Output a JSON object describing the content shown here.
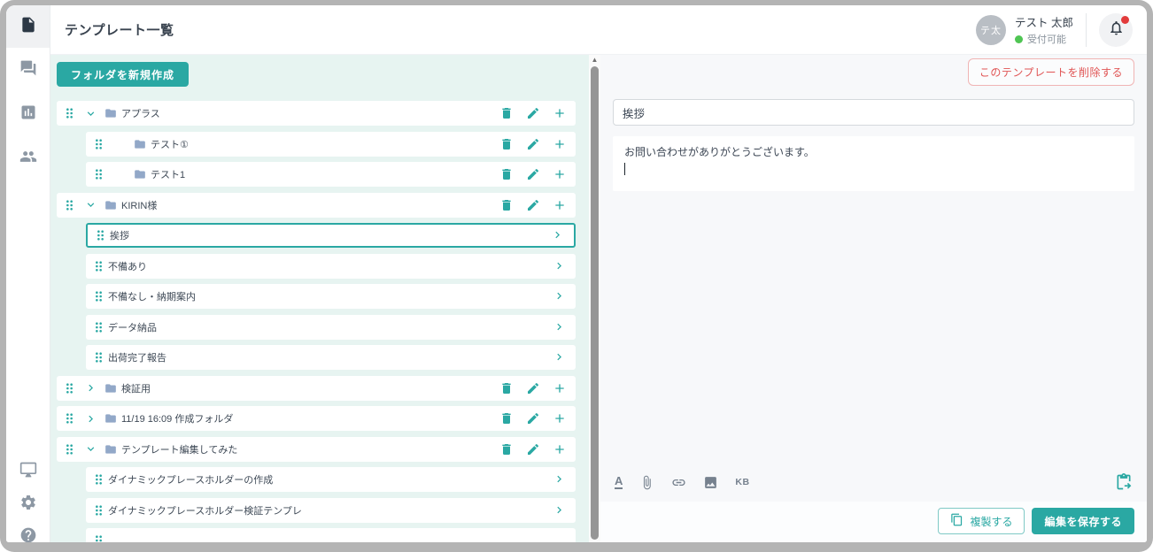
{
  "header": {
    "title": "テンプレート一覧",
    "user": {
      "avatar_initials": "テ太",
      "name": "テスト 太郎",
      "status_label": "受付可能"
    },
    "notification": {
      "icon": "bell-icon",
      "has_unread": true
    }
  },
  "sidebar": {
    "top_items": [
      {
        "icon": "document-icon",
        "active": true
      },
      {
        "icon": "chat-icon",
        "active": false
      },
      {
        "icon": "bar-chart-icon",
        "active": false
      },
      {
        "icon": "people-icon",
        "active": false
      }
    ],
    "bottom_items": [
      {
        "icon": "monitor-icon"
      },
      {
        "icon": "settings-gear-icon"
      },
      {
        "icon": "help-icon"
      }
    ]
  },
  "left_panel": {
    "new_folder_button": "フォルダを新規作成",
    "tree": [
      {
        "type": "folder",
        "label": "アプラス",
        "level": 0,
        "state": "expanded"
      },
      {
        "type": "folder",
        "label": "テスト①",
        "level": 1,
        "state": "none"
      },
      {
        "type": "folder",
        "label": "テスト1",
        "level": 1,
        "state": "none"
      },
      {
        "type": "folder",
        "label": "KIRIN様",
        "level": 0,
        "state": "expanded"
      },
      {
        "type": "template",
        "label": "挨拶",
        "level": 1,
        "selected": true
      },
      {
        "type": "template",
        "label": "不備あり",
        "level": 1
      },
      {
        "type": "template",
        "label": "不備なし・納期案内",
        "level": 1
      },
      {
        "type": "template",
        "label": "データ納品",
        "level": 1
      },
      {
        "type": "template",
        "label": "出荷完了報告",
        "level": 1
      },
      {
        "type": "folder",
        "label": "検証用",
        "level": 0,
        "state": "collapsed"
      },
      {
        "type": "folder",
        "label": "11/19 16:09 作成フォルダ",
        "level": 0,
        "state": "collapsed"
      },
      {
        "type": "folder",
        "label": "テンプレート編集してみた",
        "level": 0,
        "state": "expanded"
      },
      {
        "type": "template",
        "label": "ダイナミックプレースホルダーの作成",
        "level": 1
      },
      {
        "type": "template",
        "label": "ダイナミックプレースホルダー検証テンプレ",
        "level": 1
      },
      {
        "type": "template",
        "label": "",
        "level": 1,
        "partial": true
      }
    ]
  },
  "right_panel": {
    "delete_button": "このテンプレートを削除する",
    "template_title": "挨拶",
    "template_body": "お問い合わせがありがとうございます。",
    "toolbar": {
      "icons": [
        "text-format-icon",
        "attachment-icon",
        "link-icon",
        "image-icon"
      ],
      "kb_label": "KB",
      "paste_icon": "paste-template-icon"
    },
    "duplicate_button": "複製する",
    "save_button": "編集を保存する"
  },
  "colors": {
    "accent": "#2aa8a3",
    "danger": "#e05555",
    "folder_icon": "#92a8c8",
    "status_green": "#4fc553",
    "left_panel_bg": "#e7f4f1",
    "right_panel_bg": "#f7f8fa"
  }
}
